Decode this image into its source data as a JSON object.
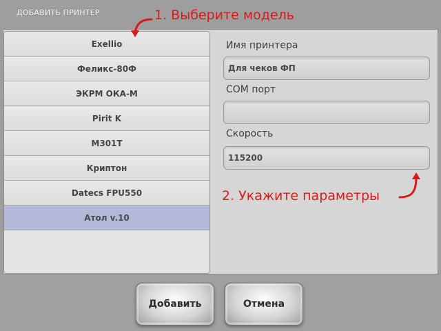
{
  "dialog": {
    "title": "ДОБАВИТЬ ПРИНТЕР"
  },
  "models": [
    {
      "label": "Exellio",
      "selected": false
    },
    {
      "label": "Феликс-80Ф",
      "selected": false
    },
    {
      "label": "ЭКРМ ОКА-М",
      "selected": false
    },
    {
      "label": "Pirit K",
      "selected": false
    },
    {
      "label": "M301T",
      "selected": false
    },
    {
      "label": "Криптон",
      "selected": false
    },
    {
      "label": "Datecs FPU550",
      "selected": false
    },
    {
      "label": "Атол v.10",
      "selected": true
    }
  ],
  "form": {
    "printer_name": {
      "label": "Имя принтера",
      "value": "Для чеков ФП"
    },
    "com_port": {
      "label": "COM порт",
      "value": ""
    },
    "speed": {
      "label": "Скорость",
      "value": "115200"
    }
  },
  "buttons": {
    "add": "Добавить",
    "cancel": "Отмена"
  },
  "annotations": {
    "step1": "1. Выберите модель",
    "step2": "2. Укажите параметры",
    "color": "#d81a1a"
  },
  "colors": {
    "selected_row": "#b4b9d9",
    "background": "#9e9e9e"
  }
}
